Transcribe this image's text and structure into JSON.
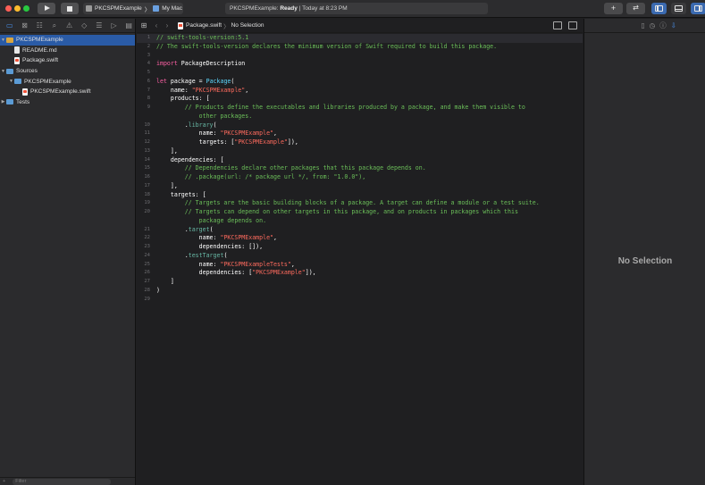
{
  "toolbar": {
    "scheme": "PKCSPMExample",
    "destination": "My Mac",
    "activity_project": "PKCSPMExample:",
    "activity_status": "Ready",
    "activity_time": "| Today at 8:23 PM",
    "add_label": "+",
    "swap_label": "⇄"
  },
  "navigator": {
    "tabs": [
      "folder-icon",
      "source-control-icon",
      "symbol-icon",
      "find-icon",
      "issue-icon",
      "test-icon",
      "debug-icon",
      "breakpoint-icon",
      "report-icon"
    ],
    "items": [
      {
        "label": "PKCSPMExample",
        "indent": 0,
        "kind": "project",
        "disclosure": "▼",
        "selected": true
      },
      {
        "label": "README.md",
        "indent": 1,
        "kind": "doc",
        "disclosure": ""
      },
      {
        "label": "Package.swift",
        "indent": 1,
        "kind": "swift",
        "disclosure": ""
      },
      {
        "label": "Sources",
        "indent": 0,
        "kind": "folder",
        "disclosure": "▼"
      },
      {
        "label": "PKCSPMExample",
        "indent": 1,
        "kind": "folder",
        "disclosure": "▼"
      },
      {
        "label": "PKCSPMExample.swift",
        "indent": 2,
        "kind": "swift",
        "disclosure": ""
      },
      {
        "label": "Tests",
        "indent": 0,
        "kind": "folder",
        "disclosure": "▶"
      }
    ],
    "filter_placeholder": "Filter"
  },
  "jumpbar": {
    "file": "Package.swift",
    "separator": "〉",
    "selection": "No Selection"
  },
  "code": [
    {
      "n": "1",
      "current": true,
      "t": [
        [
          "// swift-tools-version:5.1",
          "cm"
        ]
      ]
    },
    {
      "n": "2",
      "t": [
        [
          "// The swift-tools-version declares the minimum version of Swift required to build this package.",
          "cm"
        ]
      ]
    },
    {
      "n": "3",
      "t": []
    },
    {
      "n": "4",
      "t": [
        [
          "import",
          "kw"
        ],
        [
          " PackageDescription",
          ""
        ]
      ]
    },
    {
      "n": "5",
      "t": []
    },
    {
      "n": "6",
      "t": [
        [
          "let",
          "kw"
        ],
        [
          " package = ",
          ""
        ],
        [
          "Package",
          "ty"
        ],
        [
          "(",
          ""
        ]
      ]
    },
    {
      "n": "7",
      "t": [
        [
          "    name: ",
          ""
        ],
        [
          "\"PKCSPMExample\"",
          "st"
        ],
        [
          ",",
          ""
        ]
      ]
    },
    {
      "n": "8",
      "t": [
        [
          "    products: [",
          ""
        ]
      ]
    },
    {
      "n": "9",
      "t": [
        [
          "        // Products define the executables and libraries produced by a package, and make them visible to",
          "cm"
        ]
      ]
    },
    {
      "n": "",
      "t": [
        [
          "            other packages.",
          "cm"
        ]
      ]
    },
    {
      "n": "10",
      "t": [
        [
          "        .",
          ""
        ],
        [
          "library",
          "fn"
        ],
        [
          "(",
          ""
        ]
      ]
    },
    {
      "n": "11",
      "t": [
        [
          "            name: ",
          ""
        ],
        [
          "\"PKCSPMExample\"",
          "st"
        ],
        [
          ",",
          ""
        ]
      ]
    },
    {
      "n": "12",
      "t": [
        [
          "            targets: [",
          ""
        ],
        [
          "\"PKCSPMExample\"",
          "st"
        ],
        [
          "]),",
          ""
        ]
      ]
    },
    {
      "n": "13",
      "t": [
        [
          "    ],",
          ""
        ]
      ]
    },
    {
      "n": "14",
      "t": [
        [
          "    dependencies: [",
          ""
        ]
      ]
    },
    {
      "n": "15",
      "t": [
        [
          "        // Dependencies declare other packages that this package depends on.",
          "cm"
        ]
      ]
    },
    {
      "n": "16",
      "t": [
        [
          "        // .package(url: /* package url */, from: \"1.0.0\"),",
          "cm"
        ]
      ]
    },
    {
      "n": "17",
      "t": [
        [
          "    ],",
          ""
        ]
      ]
    },
    {
      "n": "18",
      "t": [
        [
          "    targets: [",
          ""
        ]
      ]
    },
    {
      "n": "19",
      "t": [
        [
          "        // Targets are the basic building blocks of a package. A target can define a module or a test suite.",
          "cm"
        ]
      ]
    },
    {
      "n": "20",
      "t": [
        [
          "        // Targets can depend on other targets in this package, and on products in packages which this",
          "cm"
        ]
      ]
    },
    {
      "n": "",
      "t": [
        [
          "            package depends on.",
          "cm"
        ]
      ]
    },
    {
      "n": "21",
      "t": [
        [
          "        .",
          ""
        ],
        [
          "target",
          "fn"
        ],
        [
          "(",
          ""
        ]
      ]
    },
    {
      "n": "22",
      "t": [
        [
          "            name: ",
          ""
        ],
        [
          "\"PKCSPMExample\"",
          "st"
        ],
        [
          ",",
          ""
        ]
      ]
    },
    {
      "n": "23",
      "t": [
        [
          "            dependencies: []),",
          ""
        ]
      ]
    },
    {
      "n": "24",
      "t": [
        [
          "        .",
          ""
        ],
        [
          "testTarget",
          "fn"
        ],
        [
          "(",
          ""
        ]
      ]
    },
    {
      "n": "25",
      "t": [
        [
          "            name: ",
          ""
        ],
        [
          "\"PKCSPMExampleTests\"",
          "st"
        ],
        [
          ",",
          ""
        ]
      ]
    },
    {
      "n": "26",
      "t": [
        [
          "            dependencies: [",
          ""
        ],
        [
          "\"PKCSPMExample\"",
          "st"
        ],
        [
          "]),",
          ""
        ]
      ]
    },
    {
      "n": "27",
      "t": [
        [
          "    ]",
          ""
        ]
      ]
    },
    {
      "n": "28",
      "t": [
        [
          ")",
          ""
        ]
      ]
    },
    {
      "n": "29",
      "t": []
    }
  ],
  "inspector": {
    "tabs": [
      "file-inspector-icon",
      "history-icon",
      "help-icon",
      "attributes-icon"
    ],
    "empty_label": "No Selection"
  },
  "colors": {
    "keyword": "#fc5fa3",
    "comment": "#6bbf59",
    "string": "#fc6a5d",
    "type": "#5dd8ff",
    "accent": "#3b6ab0"
  }
}
